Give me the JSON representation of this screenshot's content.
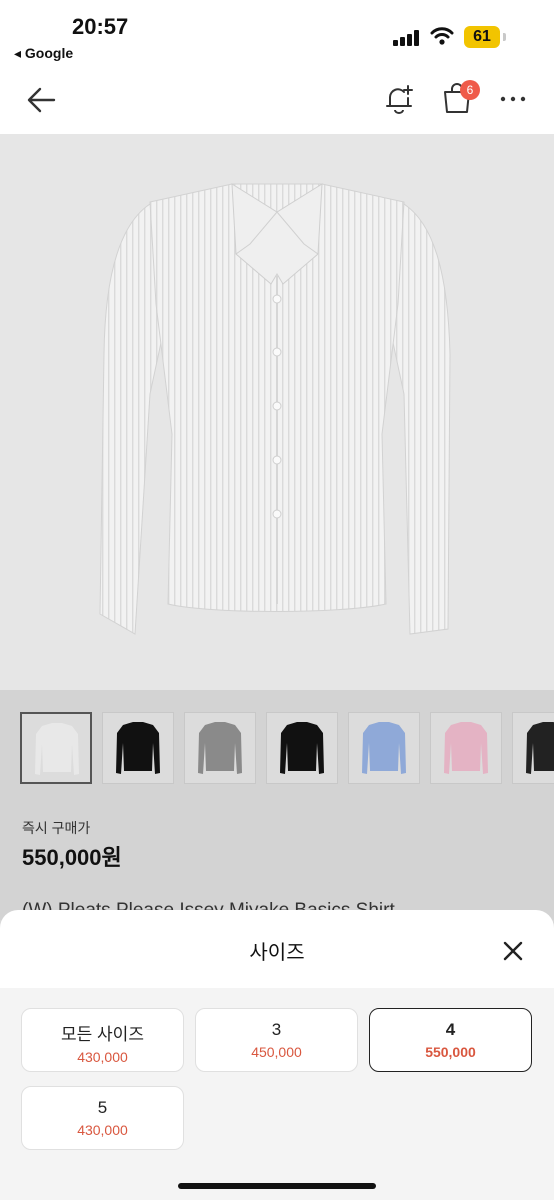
{
  "status_bar": {
    "time": "20:57",
    "back_app": "◂ Google",
    "battery": "61"
  },
  "header": {
    "cart_badge": "6"
  },
  "thumbnails": [
    {
      "color": "#e8e8e8",
      "selected": true
    },
    {
      "color": "#111111",
      "selected": false
    },
    {
      "color": "#8a8a8a",
      "selected": false
    },
    {
      "color": "#111111",
      "selected": false
    },
    {
      "color": "#8fa9d8",
      "selected": false
    },
    {
      "color": "#e4b3c4",
      "selected": false
    },
    {
      "color": "#222222",
      "selected": false
    }
  ],
  "product": {
    "price_label": "즉시 구매가",
    "price": "550,000원",
    "title": "(W) Pleats Please Issey Miyake Basics Shirt"
  },
  "sheet": {
    "title": "사이즈",
    "options": [
      {
        "size": "모든 사이즈",
        "price": "430,000",
        "selected": false
      },
      {
        "size": "3",
        "price": "450,000",
        "selected": false
      },
      {
        "size": "4",
        "price": "550,000",
        "selected": true
      },
      {
        "size": "5",
        "price": "430,000",
        "selected": false
      }
    ]
  }
}
